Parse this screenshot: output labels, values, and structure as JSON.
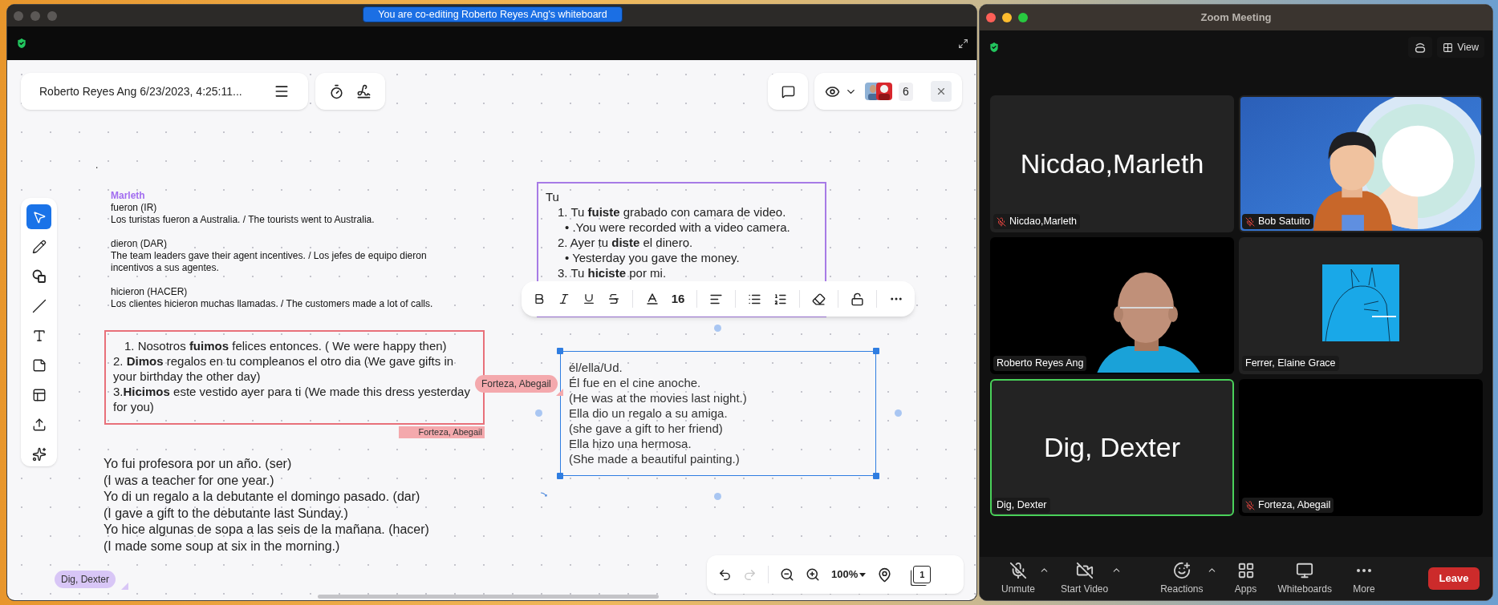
{
  "whiteboard": {
    "banner": "You are co-editing Roberto Reyes Ang's whiteboard",
    "board_title": "Roberto Reyes Ang 6/23/2023, 4:25:11...",
    "participant_count": "6",
    "tools": [
      {
        "kind": "select",
        "selected": true
      },
      {
        "kind": "pen",
        "selected": false
      },
      {
        "kind": "shapes",
        "selected": false
      },
      {
        "kind": "line",
        "selected": false
      },
      {
        "kind": "text",
        "selected": false
      },
      {
        "kind": "sticky",
        "selected": false
      },
      {
        "kind": "template",
        "selected": false
      },
      {
        "kind": "upload",
        "selected": false
      },
      {
        "kind": "magic",
        "selected": false
      }
    ],
    "stray_mark": ".",
    "notes_block": {
      "author": "Marleth",
      "entries": [
        {
          "verb": "fueron (IR)",
          "sentence": "Los turistas fueron a Australia. / The tourists went to Australia."
        },
        {
          "verb": "dieron (DAR)",
          "sentence": "The team leaders gave their agent incentives. / Los jefes de equipo dieron incentivos a sus agentes."
        },
        {
          "verb": "hicieron (HACER)",
          "sentence": "Los clientes hicieron muchas llamadas. / The customers made a lot of calls."
        }
      ]
    },
    "red_box": {
      "items": [
        "1. Nosotros **fuimos** felices entonces. ( We were happy then)",
        "2. **Dimos** regalos en tu compleanos el otro dia (We gave gifts in your birthday the other day)",
        "3.**Hicimos** este vestido ayer para ti (We made this dress yesterday for you)"
      ],
      "author_tag": "Forteza, Abegail"
    },
    "purple_box": {
      "heading": "Tu",
      "lines": [
        {
          "kind": "numbered",
          "text": "1. Tu **fuiste** grabado con camara de video."
        },
        {
          "kind": "bullet",
          "text": "• .You were recorded with a video camera."
        },
        {
          "kind": "numbered",
          "text": "2. Ayer tu **diste** el dinero."
        },
        {
          "kind": "bullet",
          "text": "• Yesterday you gave the money."
        },
        {
          "kind": "numbered",
          "text": "3. Tu **hiciste** por mi."
        }
      ]
    },
    "format_toolbar": {
      "font_size": "16"
    },
    "selected_box": {
      "lines": [
        "él/ella/Ud.",
        "Él fue en el cine anoche.",
        "(He was at the movies last night.)",
        "Ella dio un regalo a su amiga.",
        "(she gave a gift to her friend)",
        "Ella hizo una hermosa.",
        "(She made a beautiful painting.)"
      ]
    },
    "cursors": [
      {
        "name": "Forteza, Abegail",
        "color": "#f4a9ad"
      },
      {
        "name": "Dig, Dexter",
        "color": "#d8c6f6"
      }
    ],
    "bottom_text": [
      "Yo fui profesora por un año. (ser)",
      "(I was a teacher for one year.)",
      "Yo di un regalo a la debutante el domingo pasado. (dar)",
      "(I gave a gift to the debutante last Sunday.)",
      "Yo hice algunas de sopa a las seis de la mañana. (hacer)",
      "(I made some soup at six in the morning.)"
    ],
    "undo": {
      "disabled": false
    },
    "redo": {
      "disabled": true
    },
    "zoom_level": "100%",
    "page_count": "1"
  },
  "zoom": {
    "title": "Zoom Meeting",
    "view_label": "View",
    "tiles": [
      {
        "name": "Nicdao,Marleth",
        "kind": "name",
        "big_name": "Nicdao,Marleth",
        "muted": true,
        "speaking": false
      },
      {
        "name": "Bob Satuito",
        "kind": "avatar",
        "muted": true,
        "speaking": false
      },
      {
        "name": "Roberto Reyes Ang",
        "kind": "camera",
        "muted": false,
        "speaking": false
      },
      {
        "name": "Ferrer, Elaine Grace",
        "muted": false,
        "speaking": false
      },
      {
        "name": "Dig, Dexter",
        "kind": "name",
        "big_name": "Dig, Dexter",
        "muted": false,
        "speaking": true
      },
      {
        "name": "Forteza, Abegail",
        "kind": "off",
        "muted": true,
        "speaking": false
      }
    ],
    "controls": [
      {
        "kind": "mic",
        "label": "Unmute",
        "menu": true
      },
      {
        "kind": "video",
        "label": "Start Video",
        "menu": true
      },
      {
        "kind": "reactions",
        "label": "Reactions",
        "menu": true
      },
      {
        "kind": "apps",
        "label": "Apps",
        "menu": false
      },
      {
        "kind": "whiteboards",
        "label": "Whiteboards",
        "menu": false
      },
      {
        "kind": "more",
        "label": "More",
        "menu": false
      }
    ],
    "leave_label": "Leave"
  }
}
